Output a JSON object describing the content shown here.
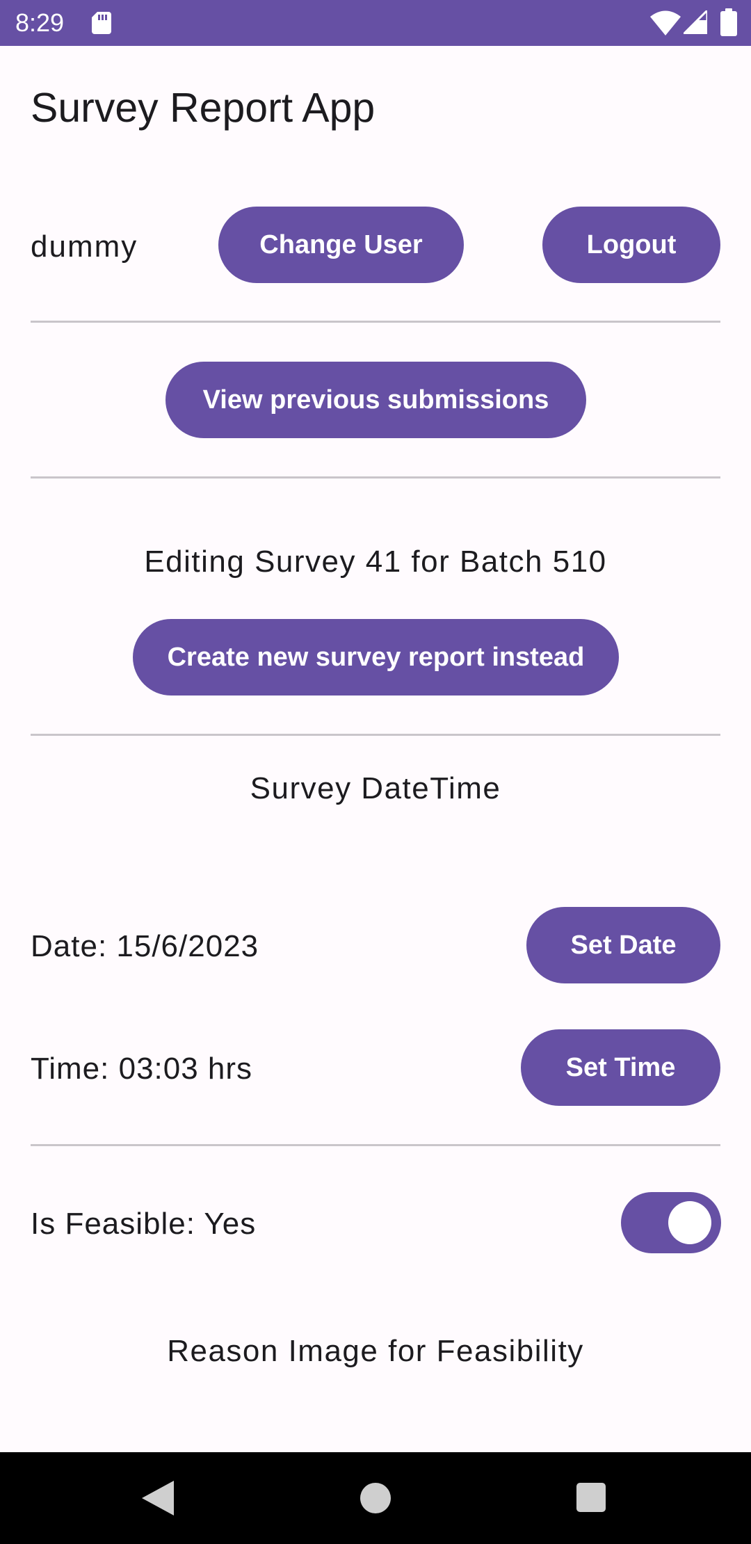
{
  "status_bar": {
    "time": "8:29",
    "icons": [
      "sd-card-icon",
      "wifi-icon",
      "signal-icon",
      "battery-icon"
    ],
    "background": "#6650a4"
  },
  "app": {
    "title": "Survey Report App"
  },
  "user": {
    "name": "dummy",
    "change_user_label": "Change User",
    "logout_label": "Logout"
  },
  "submissions": {
    "view_previous_label": "View previous submissions"
  },
  "editing": {
    "status_text": "Editing Survey 41 for Batch 510",
    "create_new_label": "Create new survey report instead"
  },
  "datetime": {
    "section_title": "Survey DateTime",
    "date_text": "Date: 15/6/2023",
    "set_date_label": "Set Date",
    "time_text": "Time: 03:03 hrs",
    "set_time_label": "Set Time"
  },
  "feasibility": {
    "label": "Is Feasible: Yes",
    "toggle_on": true,
    "reason_image_title": "Reason Image for Feasibility"
  },
  "nav_bar": {
    "icons": [
      "back-icon",
      "home-icon",
      "recents-icon"
    ]
  },
  "colors": {
    "primary": "#6650a4",
    "background": "#fffbfe",
    "text": "#1c1b1f",
    "divider": "#c9c5ca"
  }
}
